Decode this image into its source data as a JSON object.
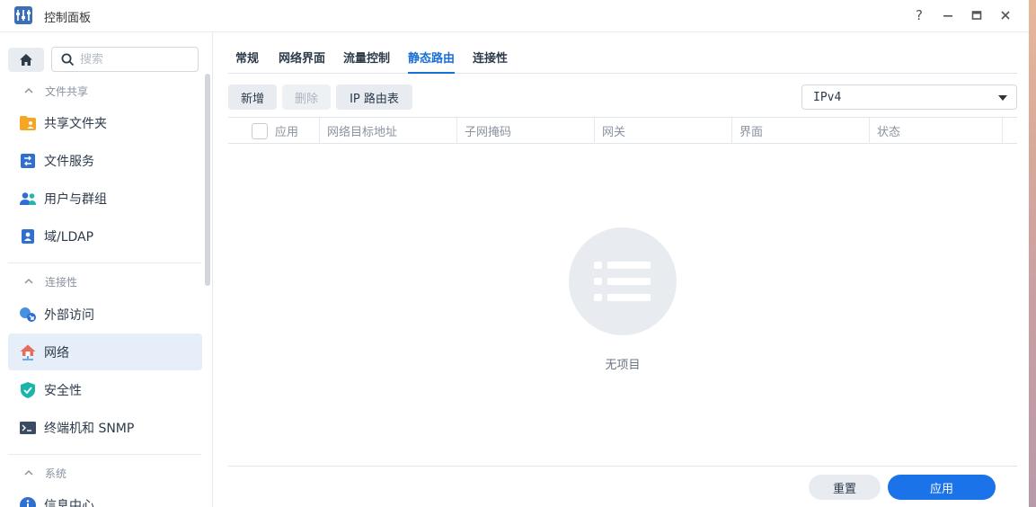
{
  "window": {
    "title": "控制面板",
    "controls": {
      "help": "?",
      "minimize": "—",
      "maximize": "□",
      "close": "✕"
    }
  },
  "sidebar": {
    "search_placeholder": "搜索",
    "sections": [
      {
        "header": "文件共享",
        "items": [
          {
            "label": "共享文件夹",
            "icon": "shared-folder-icon"
          },
          {
            "label": "文件服务",
            "icon": "file-services-icon"
          },
          {
            "label": "用户与群组",
            "icon": "users-groups-icon"
          },
          {
            "label": "域/LDAP",
            "icon": "domain-ldap-icon"
          }
        ]
      },
      {
        "header": "连接性",
        "items": [
          {
            "label": "外部访问",
            "icon": "external-access-icon"
          },
          {
            "label": "网络",
            "icon": "network-icon",
            "active": true
          },
          {
            "label": "安全性",
            "icon": "security-shield-icon"
          },
          {
            "label": "终端机和 SNMP",
            "icon": "terminal-icon"
          }
        ]
      },
      {
        "header": "系统",
        "items": [
          {
            "label": "信息中心",
            "icon": "info-center-icon"
          }
        ]
      }
    ]
  },
  "tabs": [
    {
      "label": "常规"
    },
    {
      "label": "网络界面"
    },
    {
      "label": "流量控制"
    },
    {
      "label": "静态路由",
      "active": true
    },
    {
      "label": "连接性"
    }
  ],
  "toolbar": {
    "add": "新增",
    "delete": "删除",
    "ip_route_table": "IP 路由表",
    "protocol_select": "IPv4"
  },
  "table": {
    "columns": [
      "应用",
      "网络目标地址",
      "子网掩码",
      "网关",
      "界面",
      "状态"
    ],
    "empty_text": "无项目"
  },
  "footer": {
    "reset": "重置",
    "apply": "应用"
  },
  "colors": {
    "accent": "#1a73e8",
    "active_tab": "#1a6fd6",
    "active_nav_bg": "#e6eef9"
  }
}
